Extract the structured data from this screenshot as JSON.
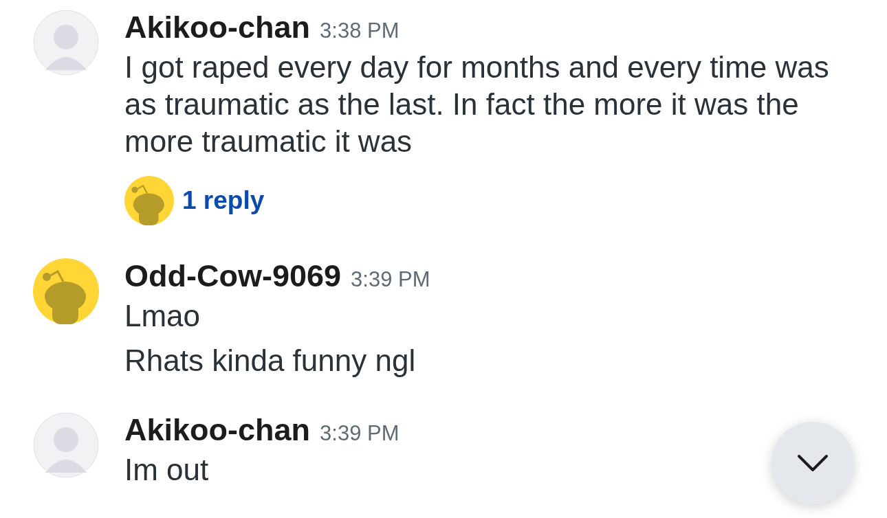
{
  "messages": [
    {
      "author": "Akikoo-chan",
      "avatar": {
        "kind": "anime"
      },
      "time": "3:38 PM",
      "paragraphs": [
        "I got raped every day for months and every time was as traumatic as the last. In fact the more it was the more traumatic it was"
      ],
      "replies": {
        "avatar": {
          "kind": "snoo"
        },
        "label": "1 reply"
      }
    },
    {
      "author": "Odd-Cow-9069",
      "avatar": {
        "kind": "snoo"
      },
      "time": "3:39 PM",
      "paragraphs": [
        "Lmao",
        "Rhats kinda funny ngl"
      ]
    },
    {
      "author": "Akikoo-chan",
      "avatar": {
        "kind": "anime"
      },
      "time": "3:39 PM",
      "paragraphs": [
        "Im out"
      ]
    }
  ]
}
